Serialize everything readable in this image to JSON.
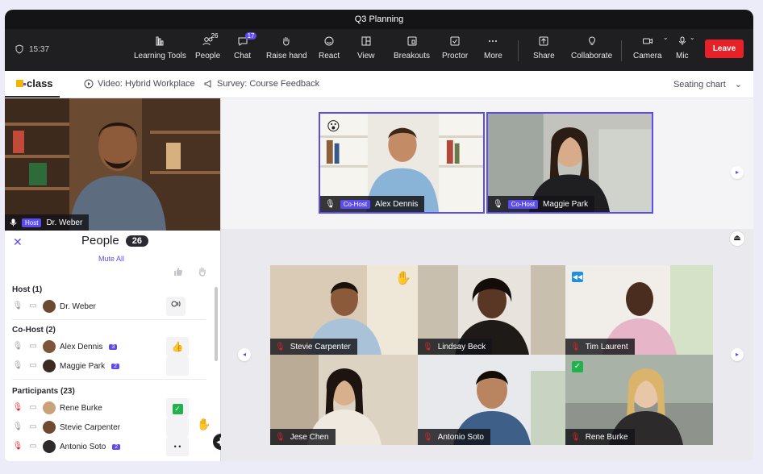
{
  "window": {
    "title": "Q3 Planning"
  },
  "status": {
    "time": "15:37"
  },
  "toolbar": {
    "items": [
      {
        "label": "Learning Tools",
        "icon": "learning-tools-icon"
      },
      {
        "label": "People",
        "icon": "people-icon",
        "badge": "26"
      },
      {
        "label": "Chat",
        "icon": "chat-icon",
        "badge": "17"
      },
      {
        "label": "Raise hand",
        "icon": "raise-hand-icon"
      },
      {
        "label": "React",
        "icon": "smiley-icon"
      },
      {
        "label": "View",
        "icon": "view-icon"
      },
      {
        "label": "Breakouts",
        "icon": "breakouts-icon"
      },
      {
        "label": "Proctor",
        "icon": "proctor-icon"
      },
      {
        "label": "More",
        "icon": "more-icon"
      },
      {
        "label": "Share",
        "icon": "share-icon"
      },
      {
        "label": "Collaborate",
        "icon": "lightbulb-icon"
      },
      {
        "label": "Camera",
        "icon": "camera-icon"
      },
      {
        "label": "Mic",
        "icon": "mic-icon"
      }
    ],
    "leave_label": "Leave"
  },
  "tabs": {
    "class_label": "class",
    "video_tab": "Video: Hybrid Workplace",
    "survey_tab": "Survey: Course Feedback",
    "seating_label": "Seating chart"
  },
  "host_video": {
    "role": "Host",
    "name": "Dr. Weber"
  },
  "people": {
    "title": "People",
    "count": "26",
    "mute_all": "Mute All",
    "sections": {
      "host": "Host (1)",
      "cohost": "Co-Host (2)",
      "participants": "Participants (23)"
    },
    "rows": [
      {
        "name": "Dr. Weber",
        "badge": ""
      },
      {
        "name": "Alex Dennis",
        "badge": "3"
      },
      {
        "name": "Maggie Park",
        "badge": "2"
      },
      {
        "name": "Rene Burke",
        "badge": ""
      },
      {
        "name": "Stevie Carpenter",
        "badge": ""
      },
      {
        "name": "Antonio Soto",
        "badge": "2"
      }
    ]
  },
  "stage": [
    {
      "role": "Co-Host",
      "name": "Alex Dennis"
    },
    {
      "role": "Co-Host",
      "name": "Maggie Park"
    }
  ],
  "grid": [
    {
      "name": "Stevie Carpenter"
    },
    {
      "name": "Lindsay Beck"
    },
    {
      "name": "Tim Laurent"
    },
    {
      "name": "Jese Chen"
    },
    {
      "name": "Antonio Soto"
    },
    {
      "name": "Rene Burke"
    }
  ],
  "colors": {
    "accent": "#5b4cf0",
    "leave": "#e42227",
    "toolbar": "#1f1f22",
    "titlebar": "#141416"
  }
}
